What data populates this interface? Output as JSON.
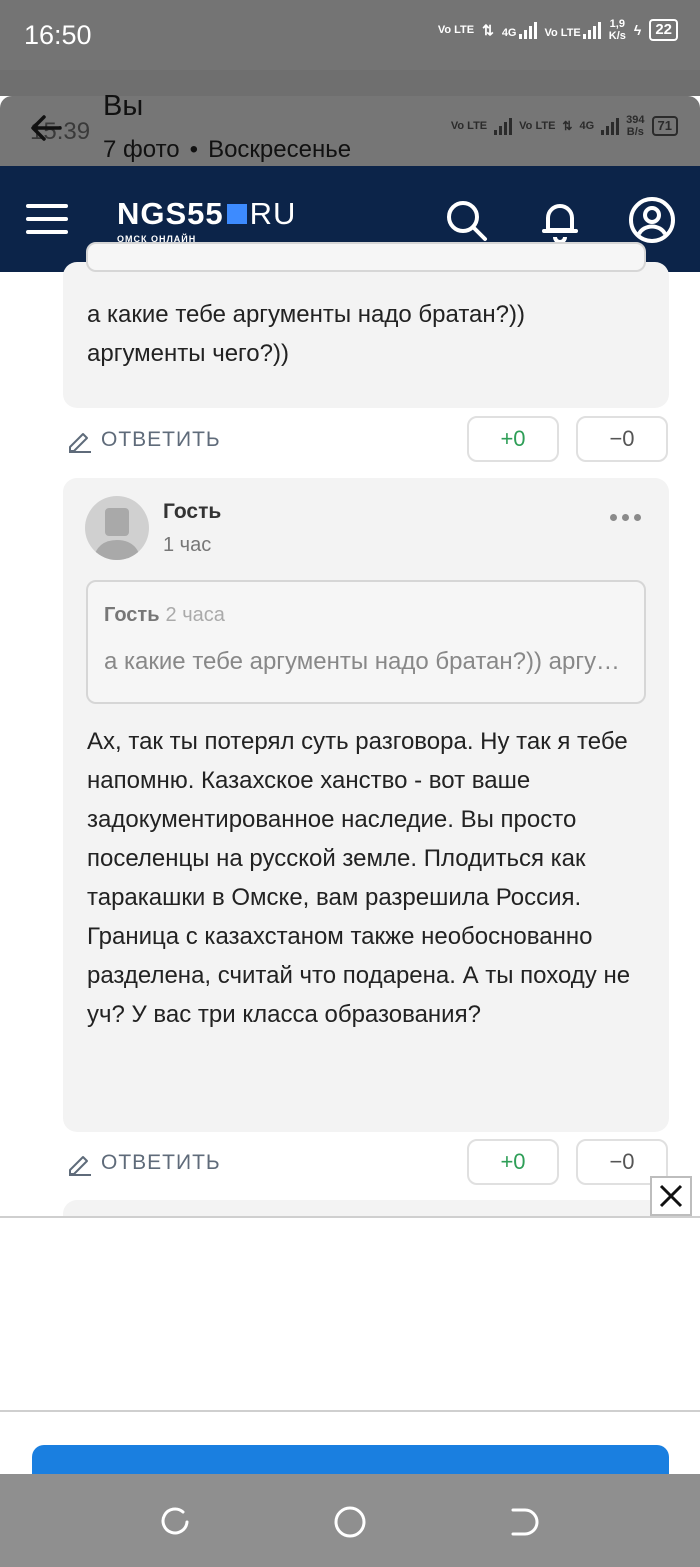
{
  "status_bar": {
    "time": "16:50",
    "sim1": "Vo LTE",
    "sim2": "Vo LTE",
    "net_type": "4G",
    "speed_value": "1,9",
    "speed_unit": "K/s",
    "battery": "22"
  },
  "gallery_header": {
    "title": "Вы",
    "photo_count": "7 фото",
    "separator": "•",
    "date": "Воскресенье",
    "inner_time": "15:39",
    "inner_speed_value": "394",
    "inner_speed_unit": "B/s",
    "inner_battery": "71"
  },
  "site": {
    "logo_main": "NGS55",
    "logo_ru": "RU",
    "logo_sub": "ОМСК ОНЛАЙН",
    "accent_color": "#3d8bff",
    "header_bg": "#0c2449"
  },
  "comments": [
    {
      "body": "а какие тебе аргументы надо братан?)) аргументы чего?))",
      "reply_label": "ОТВЕТИТЬ",
      "plus": "+0",
      "minus": "−0"
    },
    {
      "author": "Гость",
      "time_ago": "1 час",
      "quote_author": "Гость",
      "quote_time": "2 часа",
      "quote_text": "а какие тебе аргументы надо братан?)) аргументы чего?))",
      "body": "Ах, так ты потерял суть разговора. Ну так я тебе напомню. Казахское ханство - вот ваше задокументированное наследие. Вы просто поселенцы на русской земле. Плодиться как таракашки в Омске, вам разрешила Россия. Граница с казахстаном также необоснованно разделена, считай что подарена. А ты походу не уч? У вас три класса образования?",
      "reply_label": "ОТВЕТИТЬ",
      "plus": "+0",
      "minus": "−0"
    }
  ],
  "icons": {
    "menu": "hamburger-icon",
    "search": "search-icon",
    "notifications": "bell-icon",
    "profile": "user-icon",
    "reply": "pencil-icon",
    "close": "close-icon"
  }
}
